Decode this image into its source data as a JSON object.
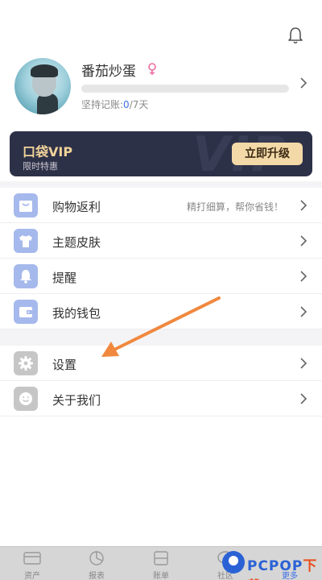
{
  "profile": {
    "username": "番茄炒蛋",
    "streak_label": "坚持记账:",
    "streak_current": "0",
    "streak_total": "/7天",
    "progress_fraction": 0
  },
  "vip": {
    "title": "口袋VIP",
    "subtitle": "限时特惠",
    "upgrade_label": "立即升级",
    "watermark": "VIP"
  },
  "menu": {
    "items": [
      {
        "label": "购物返利",
        "hint": "精打细算，帮你省钱！",
        "icon": "shopping-bag-icon"
      },
      {
        "label": "主题皮肤",
        "hint": "",
        "icon": "tshirt-icon"
      },
      {
        "label": "提醒",
        "hint": "",
        "icon": "bell-icon"
      },
      {
        "label": "我的钱包",
        "hint": "",
        "icon": "wallet-icon"
      }
    ],
    "items2": [
      {
        "label": "设置",
        "icon": "gear-icon"
      },
      {
        "label": "关于我们",
        "icon": "smiley-icon"
      }
    ]
  },
  "tabbar": {
    "tabs": [
      {
        "label": "资产",
        "icon": "card-icon"
      },
      {
        "label": "报表",
        "icon": "pie-chart-icon"
      },
      {
        "label": "账单",
        "icon": "bill-icon"
      },
      {
        "label": "社区",
        "icon": "chat-icon"
      },
      {
        "label": "更多",
        "icon": "more-icon",
        "active": true
      }
    ]
  },
  "watermark_logo": {
    "text_a": "PCPOP",
    "text_b": "下载"
  },
  "colors": {
    "accent": "#3b6ee8",
    "vip_bg": "#2d3148",
    "vip_gold": "#f1d39a",
    "arrow": "#f0883e"
  }
}
